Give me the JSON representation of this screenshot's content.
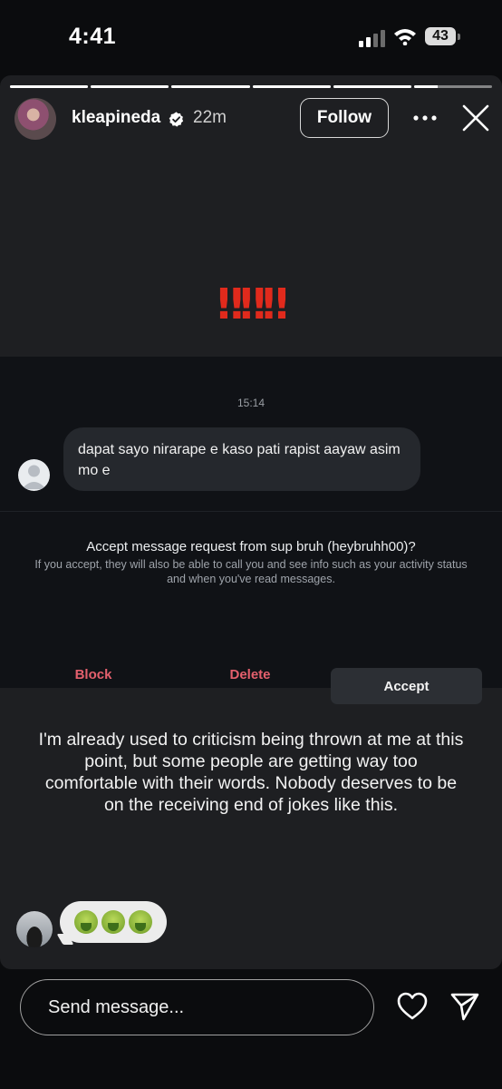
{
  "status_bar": {
    "time": "4:41",
    "battery": "43"
  },
  "story": {
    "progress_segments": 6,
    "progress_fill_last": 0.3,
    "username": "kleapineda",
    "time_ago": "22m",
    "follow_label": "Follow",
    "exclamations": "‼︎‼︎‼︎"
  },
  "dm": {
    "timestamp": "15:14",
    "message": "dapat sayo nirarape e kaso pati rapist aayaw asim mo e",
    "request_title": "Accept message request from sup bruh (heybruhh00)?",
    "request_subtitle": "If you accept, they will also be able to call you and see info such as your activity status and when you've read messages.",
    "block_label": "Block",
    "delete_label": "Delete",
    "accept_label": "Accept"
  },
  "caption": "I'm already used to criticism being thrown at me at this point, but some people are getting way too comfortable with their words. Nobody deserves to be on the receiving end of jokes like this.",
  "reply": {
    "emoji": [
      "nauseated-face",
      "nauseated-face",
      "nauseated-face"
    ]
  },
  "bottom": {
    "send_placeholder": "Send message..."
  },
  "colors": {
    "exclamation": "#e12a1c",
    "danger_text": "#e4606d",
    "background": "#0b0c0e",
    "card": "#1e1f22"
  }
}
